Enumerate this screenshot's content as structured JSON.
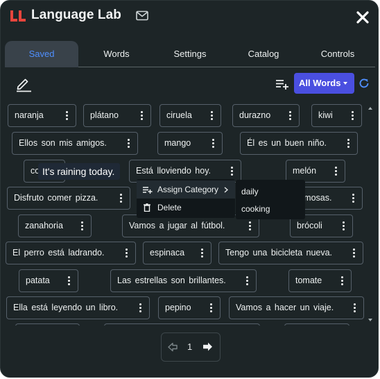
{
  "app": {
    "title": "Language Lab"
  },
  "tabs": [
    {
      "label": "Saved",
      "active": true
    },
    {
      "label": "Words"
    },
    {
      "label": "Settings"
    },
    {
      "label": "Catalog"
    },
    {
      "label": "Controls"
    }
  ],
  "toolbar": {
    "filter_label": "All Words"
  },
  "words": [
    "naranja",
    "plátano",
    "ciruela",
    "durazno",
    "kiwi",
    "Ellos son mis amigos.",
    "mango",
    "Él es un buen niño.",
    "co",
    "Está lloviendo hoy.",
    "melón",
    "Disfruto comer pizza.",
    "rmosas.",
    "zanahoria",
    "Vamos a jugar al fútbol.",
    "brócoli",
    "El perro está ladrando.",
    "espinaca",
    "Tengo una bicicleta nueva.",
    "patata",
    "Las estrellas son brillantes.",
    "tomate",
    "Ella está leyendo un libro.",
    "pepino",
    "Vamos a hacer un viaje."
  ],
  "tooltip": "It's raining today.",
  "context_menu": {
    "assign": "Assign Category",
    "delete": "Delete"
  },
  "categories": [
    "daily",
    "cooking"
  ],
  "pager": {
    "page": "1"
  },
  "colors": {
    "accent": "#4a4fe0",
    "active_tab_text": "#4f8fff",
    "logo": "#e8453c",
    "background": "#1d2527"
  }
}
